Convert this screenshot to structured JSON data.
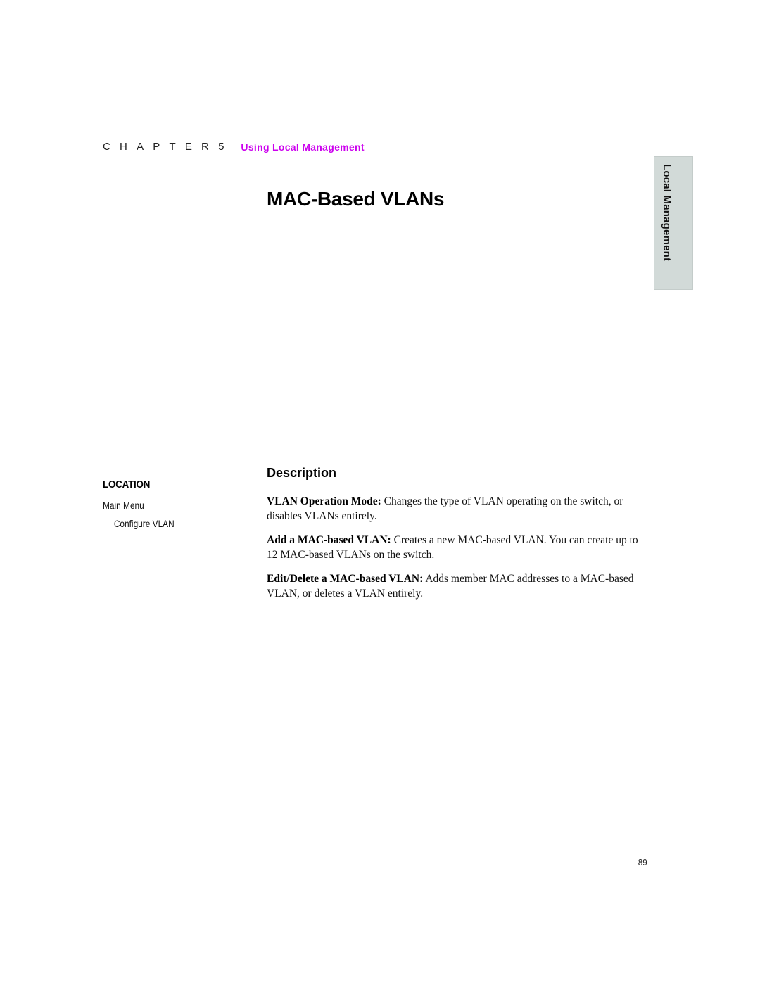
{
  "header": {
    "chapter_word": "CHAPTER",
    "chapter_number": "5",
    "chapter_title": "Using Local Management",
    "accent_color": "#cc00ee"
  },
  "side_tab": {
    "label": "Local Management",
    "background_color": "#d2dad8"
  },
  "page_title": "MAC-Based VLANs",
  "location": {
    "heading": "LOCATION",
    "path": [
      {
        "label": "Main Menu",
        "level": 0
      },
      {
        "label": "Configure VLAN",
        "level": 1
      }
    ]
  },
  "description": {
    "heading": "Description",
    "items": [
      {
        "term": "VLAN Operation Mode:",
        "text": " Changes the type of VLAN operating on the switch, or disables VLANs entirely."
      },
      {
        "term": "Add a MAC-based VLAN:",
        "text": " Creates a new MAC-based VLAN. You can create up to 12 MAC-based VLANs on the switch."
      },
      {
        "term": "Edit/Delete a MAC-based VLAN:",
        "text": " Adds member MAC addresses to a MAC-based VLAN, or deletes a VLAN entirely."
      }
    ]
  },
  "page_number": "89"
}
